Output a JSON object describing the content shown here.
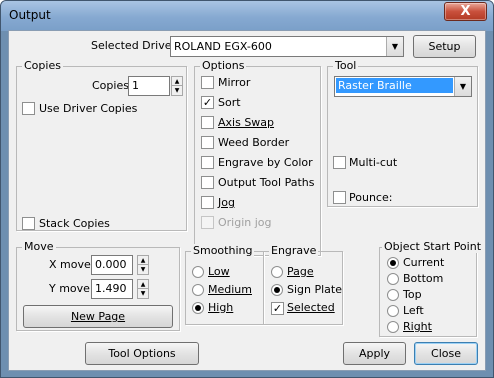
{
  "window": {
    "title": "Output",
    "close_glyph": "X"
  },
  "driver": {
    "label": "Selected Driver:",
    "value": "ROLAND EGX-600",
    "setup_button": "Setup"
  },
  "copies": {
    "group_title": "Copies",
    "copies_label": "Copies:",
    "copies_value": "1",
    "use_driver_copies": {
      "label": "Use Driver Copies",
      "checked": false
    },
    "stack_copies": {
      "label": "Stack Copies",
      "checked": false
    }
  },
  "options": {
    "group_title": "Options",
    "items": [
      {
        "label": "Mirror",
        "checked": false,
        "enabled": true
      },
      {
        "label": "Sort",
        "checked": true,
        "enabled": true
      },
      {
        "label": "Axis Swap",
        "checked": false,
        "enabled": true
      },
      {
        "label": "Weed Border",
        "checked": false,
        "enabled": true
      },
      {
        "label": "Engrave by Color",
        "checked": false,
        "enabled": true
      },
      {
        "label": "Output Tool Paths",
        "checked": false,
        "enabled": true
      },
      {
        "label": "Jog",
        "checked": false,
        "enabled": true
      },
      {
        "label": "Origin jog",
        "checked": false,
        "enabled": false
      }
    ]
  },
  "tool": {
    "group_title": "Tool",
    "selected": "Raster Braille",
    "multi_cut": {
      "label": "Multi-cut",
      "checked": false
    },
    "pounce": {
      "label": "Pounce:",
      "checked": false
    }
  },
  "move": {
    "group_title": "Move",
    "x_label": "X move:",
    "x_value": "0.000",
    "y_label": "Y move:",
    "y_value": "1.490",
    "new_page_button": "New Page"
  },
  "smoothing": {
    "group_title": "Smoothing",
    "options": [
      {
        "label": "Low",
        "checked": false
      },
      {
        "label": "Medium",
        "checked": false
      },
      {
        "label": "High",
        "checked": true
      }
    ]
  },
  "engrave": {
    "group_title": "Engrave",
    "options": [
      {
        "label": "Page",
        "checked": false
      },
      {
        "label": "Sign Plate",
        "checked": true
      }
    ],
    "selected": {
      "label": "Selected",
      "checked": true
    }
  },
  "start_point": {
    "group_title": "Object Start Point",
    "options": [
      {
        "label": "Current",
        "checked": true
      },
      {
        "label": "Bottom",
        "checked": false
      },
      {
        "label": "Top",
        "checked": false
      },
      {
        "label": "Left",
        "checked": false
      },
      {
        "label": "Right",
        "checked": false
      }
    ]
  },
  "footer": {
    "tool_options_button": "Tool Options",
    "apply_button": "Apply",
    "close_button": "Close"
  },
  "colors": {
    "title_bar": "#86a9d1",
    "close_button": "#c9503c",
    "selection": "#3399ff"
  },
  "icons": {
    "dropdown": "chevron-down-icon",
    "spin_up": "spin-up-icon",
    "spin_down": "spin-down-icon",
    "check": "check-icon",
    "close": "close-icon"
  }
}
